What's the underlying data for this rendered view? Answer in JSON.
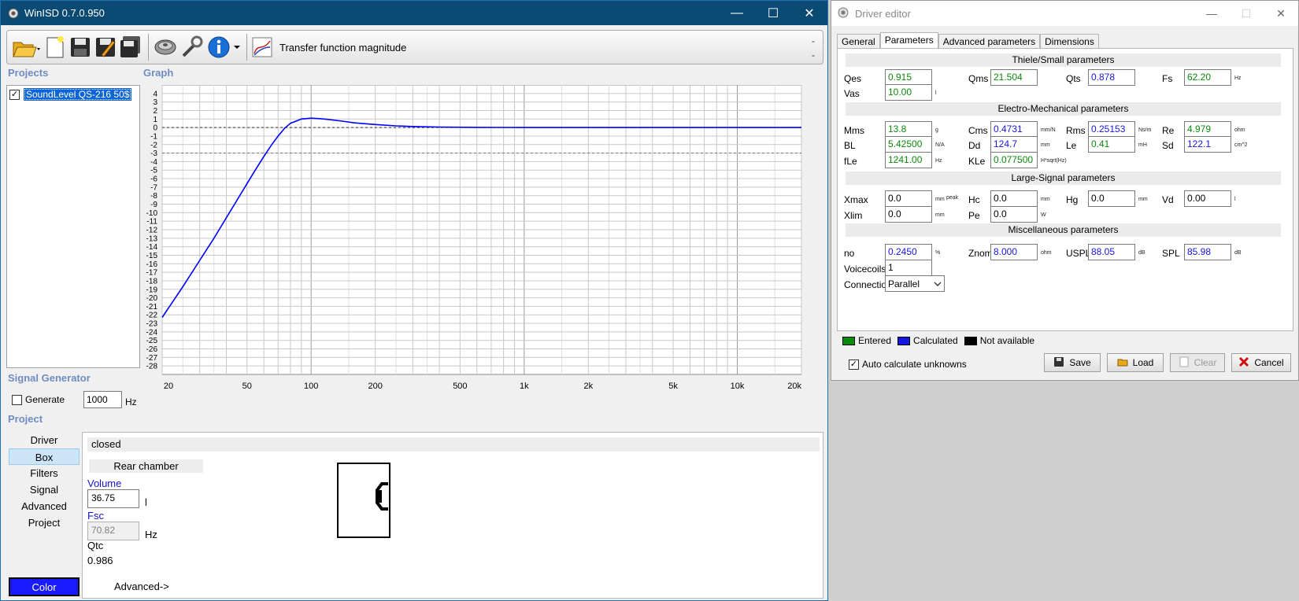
{
  "winisd": {
    "title": "WinISD 0.7.0.950",
    "toolbar": {
      "view_label": "Transfer function magnitude",
      "right_markers": [
        "-",
        "-"
      ]
    },
    "sections": {
      "projects": "Projects",
      "graph": "Graph",
      "signal_generator": "Signal Generator",
      "project": "Project"
    },
    "projects": [
      {
        "name": "SoundLevel QS-216 50$",
        "checked": true
      }
    ],
    "signal_generator": {
      "generate_label": "Generate",
      "frequency": "1000",
      "unit": "Hz"
    },
    "project_nav": [
      "Driver",
      "Box",
      "Filters",
      "Signal",
      "Advanced",
      "Project"
    ],
    "project_nav_active": "Box",
    "color_button": "Color",
    "color_button_color": "#1a1aff",
    "box": {
      "type": "closed",
      "rear_chamber": "Rear chamber",
      "volume_label": "Volume",
      "volume": "36.75",
      "volume_unit": "l",
      "fsc_label": "Fsc",
      "fsc": "70.82",
      "fsc_unit": "Hz",
      "qtc_label": "Qtc",
      "qtc": "0.986",
      "advanced_link": "Advanced->"
    }
  },
  "chart_data": {
    "type": "line",
    "x_scale": "log",
    "xlim": [
      20,
      20000
    ],
    "ylim": [
      -29,
      5
    ],
    "x_ticks": [
      {
        "value": 20,
        "label": "20"
      },
      {
        "value": 50,
        "label": "50"
      },
      {
        "value": 100,
        "label": "100"
      },
      {
        "value": 200,
        "label": "200"
      },
      {
        "value": 500,
        "label": "500"
      },
      {
        "value": 1000,
        "label": "1k"
      },
      {
        "value": 2000,
        "label": "2k"
      },
      {
        "value": 5000,
        "label": "5k"
      },
      {
        "value": 10000,
        "label": "10k"
      },
      {
        "value": 20000,
        "label": "20k"
      }
    ],
    "y_ticks": [
      4,
      3,
      2,
      1,
      0,
      -1,
      -2,
      -3,
      -4,
      -5,
      -6,
      -7,
      -8,
      -9,
      -10,
      -11,
      -12,
      -13,
      -14,
      -15,
      -16,
      -17,
      -18,
      -19,
      -20,
      -21,
      -22,
      -23,
      -24,
      -25,
      -26,
      -27,
      -28
    ],
    "reference_lines": [
      0,
      -3
    ],
    "grid": true,
    "series": [
      {
        "color": "#0000ff",
        "x": [
          20,
          25,
          30,
          35,
          40,
          45,
          50,
          55,
          60,
          65,
          70,
          75,
          80,
          90,
          100,
          110,
          120,
          140,
          160,
          200,
          250,
          300,
          400,
          600,
          1000,
          2000,
          5000,
          10000,
          20000
        ],
        "y": [
          -22.3,
          -18.7,
          -15.6,
          -13.0,
          -10.6,
          -8.5,
          -6.6,
          -4.9,
          -3.4,
          -2.1,
          -1.0,
          -0.1,
          0.5,
          1.0,
          1.1,
          1.05,
          0.95,
          0.75,
          0.55,
          0.35,
          0.2,
          0.12,
          0.06,
          0.02,
          0.0,
          0.0,
          0.0,
          0.0,
          0.0
        ]
      }
    ]
  },
  "driver_editor": {
    "title": "Driver editor",
    "tabs": [
      "General",
      "Parameters",
      "Advanced parameters",
      "Dimensions"
    ],
    "active_tab": "Parameters",
    "groups": {
      "ts": "Thiele/Small parameters",
      "em": "Electro-Mechanical parameters",
      "ls": "Large-Signal parameters",
      "misc": "Miscellaneous parameters"
    },
    "params": {
      "qes": {
        "label": "Qes",
        "value": "0.915",
        "state": "entered",
        "unit": ""
      },
      "qms": {
        "label": "Qms",
        "value": "21.504",
        "state": "entered",
        "unit": ""
      },
      "qts": {
        "label": "Qts",
        "value": "0.878",
        "state": "calc",
        "unit": ""
      },
      "fs": {
        "label": "Fs",
        "value": "62.20",
        "state": "entered",
        "unit": "Hz"
      },
      "vas": {
        "label": "Vas",
        "value": "10.00",
        "state": "entered",
        "unit": "l"
      },
      "mms": {
        "label": "Mms",
        "value": "13.8",
        "state": "entered",
        "unit": "g"
      },
      "cms": {
        "label": "Cms",
        "value": "0.4731",
        "state": "calc",
        "unit": "mm/N"
      },
      "rms": {
        "label": "Rms",
        "value": "0.25153",
        "state": "calc",
        "unit": "Ns/m"
      },
      "re": {
        "label": "Re",
        "value": "4.979",
        "state": "entered",
        "unit": "ohm"
      },
      "bl": {
        "label": "BL",
        "value": "5.42500",
        "state": "entered",
        "unit": "N/A"
      },
      "dd": {
        "label": "Dd",
        "value": "124.7",
        "state": "calc",
        "unit": "mm"
      },
      "le": {
        "label": "Le",
        "value": "0.41",
        "state": "entered",
        "unit": "mH"
      },
      "sd": {
        "label": "Sd",
        "value": "122.1",
        "state": "calc",
        "unit": "cm^2"
      },
      "fle": {
        "label": "fLe",
        "value": "1241.00",
        "state": "entered",
        "unit": "Hz"
      },
      "kle": {
        "label": "KLe",
        "value": "0.077500",
        "state": "entered",
        "unit": "H*sqrt(Hz)"
      },
      "xmax": {
        "label": "Xmax",
        "value": "0.0",
        "state": "na",
        "unit": "mm",
        "unit2": "peak"
      },
      "hc": {
        "label": "Hc",
        "value": "0.0",
        "state": "na",
        "unit": "mm"
      },
      "hg": {
        "label": "Hg",
        "value": "0.0",
        "state": "na",
        "unit": "mm"
      },
      "vd": {
        "label": "Vd",
        "value": "0.00",
        "state": "na",
        "unit": "l"
      },
      "xlim": {
        "label": "Xlim",
        "value": "0.0",
        "state": "na",
        "unit": "mm"
      },
      "pe": {
        "label": "Pe",
        "value": "0.0",
        "state": "na",
        "unit": "W"
      },
      "no": {
        "label": "no",
        "value": "0.2450",
        "state": "calc",
        "unit": "%"
      },
      "znom": {
        "label": "Znom",
        "value": "8.000",
        "state": "calc",
        "unit": "ohm"
      },
      "uspl": {
        "label": "USPL",
        "value": "88.05",
        "state": "calc",
        "unit": "dB"
      },
      "spl": {
        "label": "SPL",
        "value": "85.98",
        "state": "calc",
        "unit": "dB"
      },
      "voicecoils": {
        "label": "Voicecoils",
        "value": "1",
        "state": "na",
        "unit": ""
      }
    },
    "connection": {
      "label": "Connection",
      "value": "Parallel"
    },
    "legend": [
      {
        "label": "Entered",
        "color": "#0a8a0a"
      },
      {
        "label": "Calculated",
        "color": "#1515e0"
      },
      {
        "label": "Not available",
        "color": "#000000"
      }
    ],
    "auto_calc_label": "Auto calculate unknowns",
    "buttons": {
      "save": "Save",
      "load": "Load",
      "clear": "Clear",
      "cancel": "Cancel"
    }
  }
}
